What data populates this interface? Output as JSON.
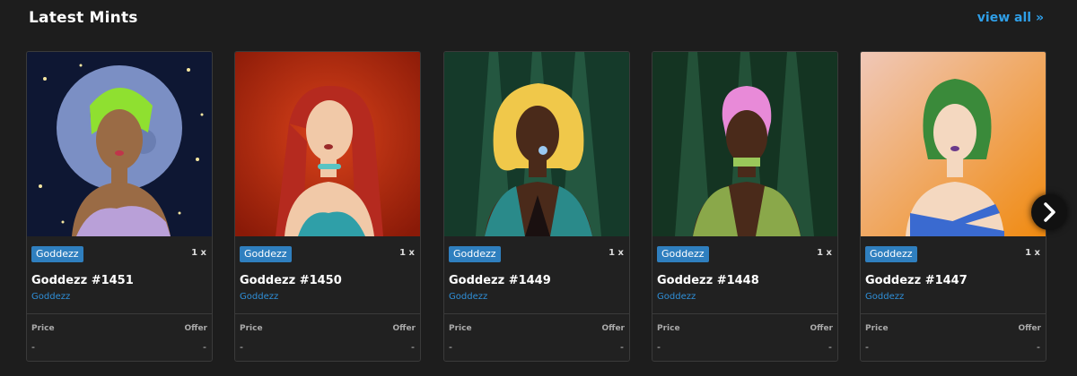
{
  "header": {
    "title": "Latest Mints",
    "view_all": "view all »"
  },
  "labels": {
    "price": "Price",
    "offer": "Offer"
  },
  "cards": [
    {
      "tag": "Goddezz",
      "qty": "1 x",
      "name": "Goddezz #1451",
      "collection": "Goddezz",
      "price": "-",
      "offer": "-"
    },
    {
      "tag": "Goddezz",
      "qty": "1 x",
      "name": "Goddezz #1450",
      "collection": "Goddezz",
      "price": "-",
      "offer": "-"
    },
    {
      "tag": "Goddezz",
      "qty": "1 x",
      "name": "Goddezz #1449",
      "collection": "Goddezz",
      "price": "-",
      "offer": "-"
    },
    {
      "tag": "Goddezz",
      "qty": "1 x",
      "name": "Goddezz #1448",
      "collection": "Goddezz",
      "price": "-",
      "offer": "-"
    },
    {
      "tag": "Goddezz",
      "qty": "1 x",
      "name": "Goddezz #1447",
      "collection": "Goddezz",
      "price": "-",
      "offer": "-"
    }
  ],
  "icons": {
    "next": "chevron-right-icon"
  },
  "colors": {
    "accent": "#2f9fe8",
    "tag_bg": "#2f7fbf",
    "background": "#1d1d1d",
    "card_bg": "#212121"
  }
}
